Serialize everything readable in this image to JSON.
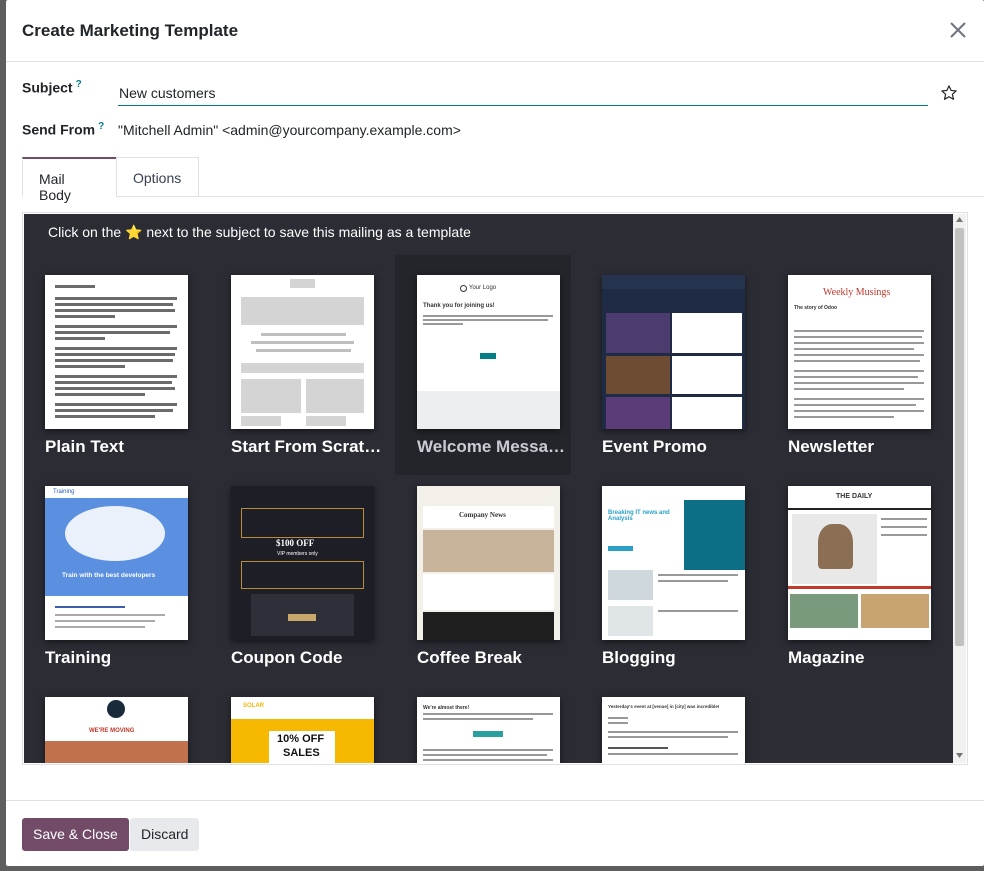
{
  "dialog": {
    "title": "Create Marketing Template",
    "subject_label": "Subject",
    "subject_value": "New customers",
    "help_mark": "?",
    "send_from_label": "Send From",
    "send_from_value": "\"Mitchell Admin\" <admin@yourcompany.example.com>"
  },
  "tabs": [
    {
      "label": "Mail Body",
      "active": true
    },
    {
      "label": "Options",
      "active": false
    }
  ],
  "gallery": {
    "hint": "Click on the ⭐ next to the subject to save this mailing as a template",
    "templates": [
      {
        "label": "Plain Text"
      },
      {
        "label": "Start From Scrat…"
      },
      {
        "label": "Welcome Messa…"
      },
      {
        "label": "Event Promo"
      },
      {
        "label": "Newsletter"
      },
      {
        "label": "Training"
      },
      {
        "label": "Coupon Code"
      },
      {
        "label": "Coffee Break"
      },
      {
        "label": "Blogging"
      },
      {
        "label": "Magazine"
      }
    ],
    "thumb_text": {
      "welcome_logo": "Your Logo",
      "welcome_heading": "Thank you for joining us!",
      "newsletter_title": "Weekly Musings",
      "newsletter_story": "The story of Odoo",
      "training_title": "Train with the best developers",
      "training_brand": "Training",
      "coupon_amount": "$100 OFF",
      "coupon_sub": "VIP members only",
      "coffee_title": "Company News",
      "blog_title": "Breaking IT news and Analysis",
      "magazine_title": "THE DAILY",
      "moving": "WE'RE MOVING",
      "solar_brand": "SOLAR",
      "solar_offer": "10% OFF",
      "solar_offer2": "SALES",
      "almost_there": "We're almost there!",
      "event_recap": "Yesterday's event at [venue] in [city] was incredible!"
    }
  },
  "footer": {
    "save_label": "Save & Close",
    "discard_label": "Discard"
  },
  "colors": {
    "primary": "#714b67",
    "accent": "#017e84",
    "gallery_bg": "#2b2c34"
  }
}
